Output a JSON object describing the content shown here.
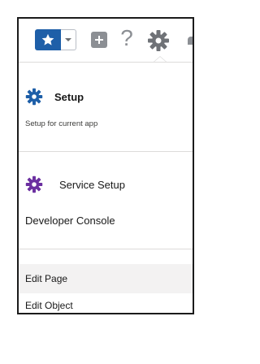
{
  "toolbar": {
    "favorites_icon": "star-icon",
    "favorites_menu_icon": "chevron-down-icon",
    "global_actions_icon": "plus-icon",
    "help_label": "?",
    "setup_icon": "gear-icon",
    "notifications_icon": "bell-icon"
  },
  "menu": {
    "setup": {
      "title": "Setup",
      "subtitle": "Setup for current app",
      "icon": "gear-icon",
      "icon_color": "#1e5fa8"
    },
    "service_setup": {
      "label": "Service Setup",
      "icon": "gear-icon",
      "icon_color": "#6b2fa0"
    },
    "developer_console": "Developer Console",
    "edit_page": "Edit Page",
    "edit_object": "Edit Object"
  },
  "colors": {
    "accent": "#1e5fa8",
    "service_accent": "#6b2fa0",
    "toolbar_icon": "#8c8f94",
    "hover_row": "#f3f2f2"
  }
}
